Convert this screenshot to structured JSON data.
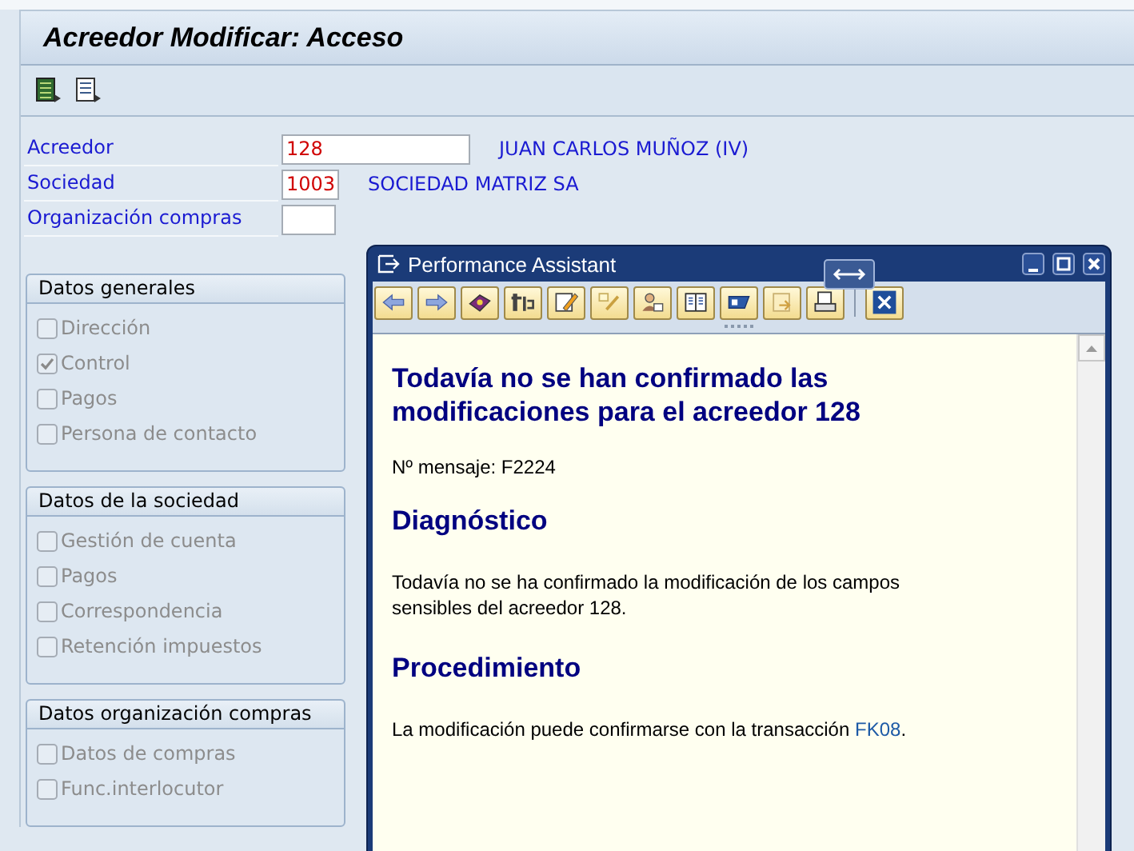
{
  "title": "Acreedor Modificar: Acceso",
  "fields": [
    {
      "label": "Acreedor",
      "value": "128",
      "description": "JUAN CARLOS MUÑOZ (IV)"
    },
    {
      "label": "Sociedad",
      "value": "1003",
      "description": "SOCIEDAD MATRIZ SA"
    },
    {
      "label": "Organización compras"
    }
  ],
  "groups": [
    {
      "title": "Datos generales",
      "options": [
        {
          "label": "Dirección",
          "checked": false,
          "disabled": true
        },
        {
          "label": "Control",
          "checked": true,
          "disabled": true
        },
        {
          "label": "Pagos",
          "checked": false,
          "disabled": true
        },
        {
          "label": "Persona de contacto",
          "checked": false,
          "disabled": true
        }
      ]
    },
    {
      "title": "Datos de la sociedad",
      "options": [
        {
          "label": "Gestión de cuenta",
          "checked": false,
          "disabled": true
        },
        {
          "label": "Pagos",
          "checked": false,
          "disabled": true
        },
        {
          "label": "Correspondencia",
          "checked": false,
          "disabled": true
        },
        {
          "label": "Retención impuestos",
          "checked": false,
          "disabled": true
        }
      ]
    },
    {
      "title": "Datos organización compras",
      "options": [
        {
          "label": "Datos de compras",
          "checked": false,
          "disabled": true
        },
        {
          "label": "Func.interlocutor",
          "checked": false,
          "disabled": true
        }
      ]
    }
  ],
  "assistant": {
    "title": "Performance Assistant",
    "heading": "Todavía no se han confirmado las modificaciones para el acreedor 128",
    "message_number": "Nº mensaje: F2224",
    "sections": [
      {
        "heading": "Diagnóstico",
        "text": "Todavía no se ha confirmado la modificación de los campos sensibles del acreedor 128."
      },
      {
        "heading": "Procedimiento",
        "text": "La modificación puede confirmarse con la transacción ",
        "link": "FK08",
        "text_after": "."
      }
    ]
  }
}
